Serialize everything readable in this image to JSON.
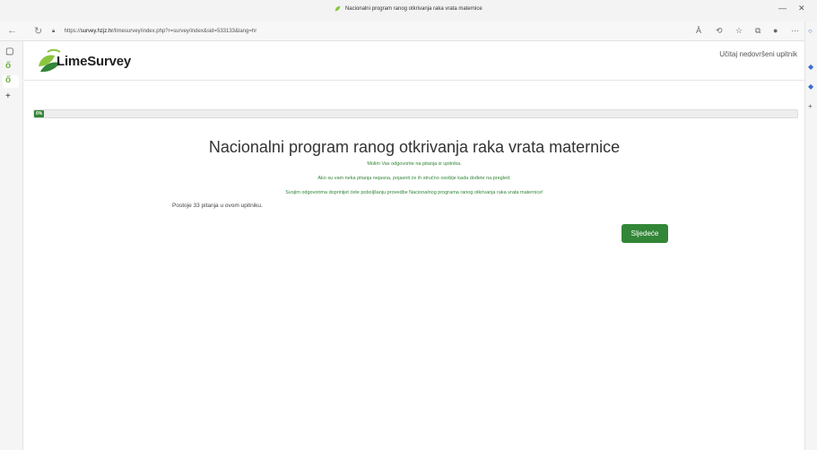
{
  "window": {
    "title": "Nacionalni program ranog otkrivanja raka vrata maternice",
    "minimize_glyph": "—",
    "close_glyph": "✕"
  },
  "browser": {
    "url_prefix": "https://",
    "url_host": "survey.hzjz.hr",
    "url_path": "/limesurvey/index.php?r=survey/index&sid=533133&lang=hr",
    "read_aloud_label": "Ā"
  },
  "header": {
    "logo_text": "LimeSurvey",
    "resume_link": "Učitaj nedovršeni upitnik"
  },
  "progress": {
    "label": "0%",
    "value": 0
  },
  "survey": {
    "title": "Nacionalni program ranog otkrivanja raka vrata maternice",
    "desc_line1": "Molim Vas odgovorite na pitanja iz upitnika.",
    "desc_line2": "Ako su vam neka pitanja nejasna, pojasnit će ih stručno osoblje kada dođete na pregled.",
    "desc_line3": "Svojim odgovorima doprinijet ćete poboljšanju provedbe Nacionalnog programa ranog otkrivanja raka vrata maternice!",
    "question_count_text": "Postoje 33 pitanja u ovom upitniku."
  },
  "actions": {
    "next_label": "Sljedeće"
  },
  "colors": {
    "primary_green": "#328637",
    "lime_logo": "#8bc53f"
  },
  "icons": [
    "refresh-icon",
    "lock-icon",
    "back-icon",
    "favorites-icon",
    "collections-icon",
    "profile-icon",
    "more-icon",
    "leaf-icon",
    "tab-actions-icon",
    "new-tab-icon"
  ]
}
